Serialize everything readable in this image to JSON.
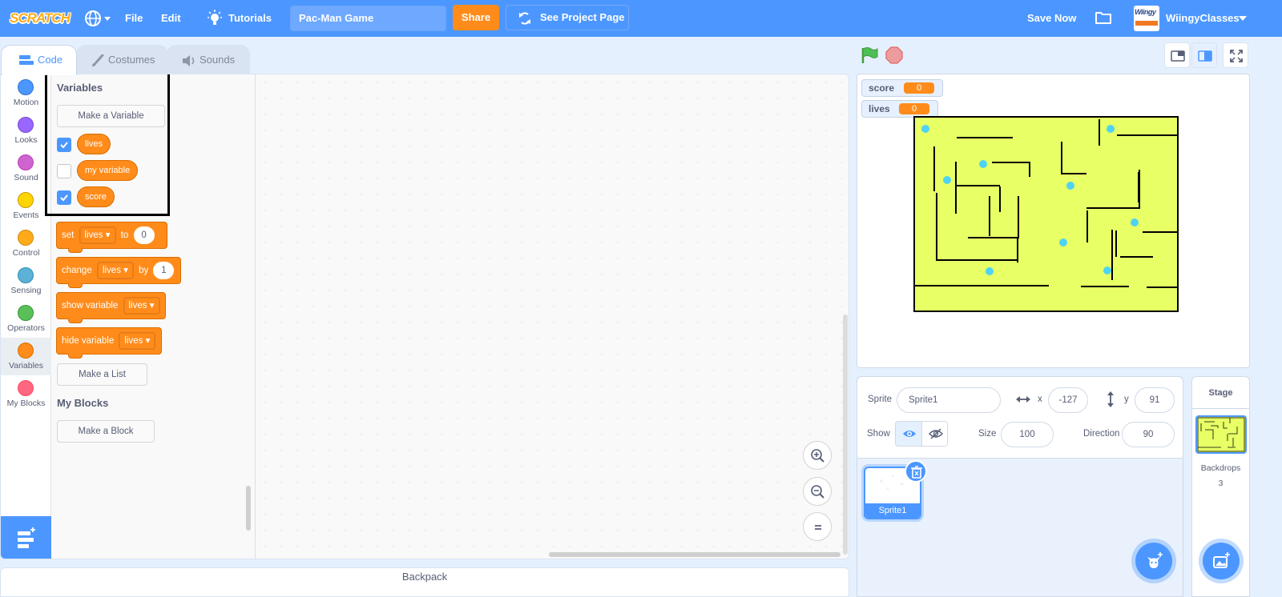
{
  "menubar": {
    "logo": "SCRATCH",
    "file": "File",
    "edit": "Edit",
    "tutorials": "Tutorials",
    "project_title": "Pac-Man Game",
    "share": "Share",
    "see_project_page": "See Project Page",
    "save_now": "Save Now",
    "avatar_text": "Wiingy",
    "username": "WiingyClasses"
  },
  "tabs": [
    {
      "label": "Code",
      "active": true
    },
    {
      "label": "Costumes",
      "active": false
    },
    {
      "label": "Sounds",
      "active": false
    }
  ],
  "categories": [
    {
      "label": "Motion",
      "color": "#4c97ff"
    },
    {
      "label": "Looks",
      "color": "#9966ff"
    },
    {
      "label": "Sound",
      "color": "#cf63cf"
    },
    {
      "label": "Events",
      "color": "#ffd500"
    },
    {
      "label": "Control",
      "color": "#ffab19"
    },
    {
      "label": "Sensing",
      "color": "#5cb1d6"
    },
    {
      "label": "Operators",
      "color": "#59c059"
    },
    {
      "label": "Variables",
      "color": "#ff8c1a",
      "selected": true
    },
    {
      "label": "My Blocks",
      "color": "#ff6680"
    }
  ],
  "flyout": {
    "variables_header": "Variables",
    "make_variable": "Make a Variable",
    "variables": [
      {
        "name": "lives",
        "checked": true
      },
      {
        "name": "my variable",
        "checked": false
      },
      {
        "name": "score",
        "checked": true
      }
    ],
    "blocks": {
      "set": {
        "w1": "set",
        "var": "lives",
        "w2": "to",
        "value": "0"
      },
      "change": {
        "w1": "change",
        "var": "lives",
        "w2": "by",
        "value": "1"
      },
      "show": {
        "w1": "show variable",
        "var": "lives"
      },
      "hide": {
        "w1": "hide variable",
        "var": "lives"
      }
    },
    "make_list": "Make a List",
    "my_blocks_header": "My Blocks",
    "make_block": "Make a Block"
  },
  "backpack": "Backpack",
  "stage": {
    "monitors": [
      {
        "name": "score",
        "value": "0"
      },
      {
        "name": "lives",
        "value": "0"
      }
    ],
    "maze_color": "#e8ff66",
    "dot_color": "#4fd3f2"
  },
  "sprite_info": {
    "sprite_label": "Sprite",
    "sprite_name": "Sprite1",
    "x_label": "x",
    "x_value": "-127",
    "y_label": "y",
    "y_value": "91",
    "show_label": "Show",
    "size_label": "Size",
    "size_value": "100",
    "direction_label": "Direction",
    "direction_value": "90"
  },
  "sprites": [
    {
      "name": "Sprite1",
      "selected": true
    }
  ],
  "stage_pane": {
    "title": "Stage",
    "backdrops_label": "Backdrops",
    "backdrops_count": "3"
  },
  "colors": {
    "menubar": "#4c97ff",
    "variables": "#ff8c1a",
    "share": "#ff8c1a"
  }
}
